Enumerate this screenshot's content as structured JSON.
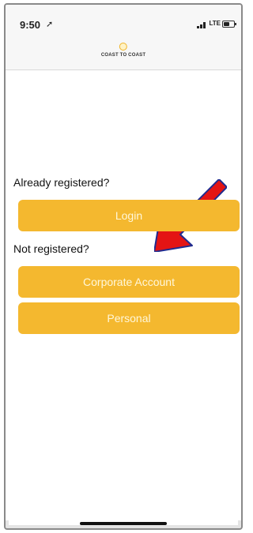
{
  "status_bar": {
    "time": "9:50",
    "time_arrow": "➚",
    "network": "LTE",
    "battery_level": 0.55
  },
  "nav": {
    "logo_text": "COAST TO COAST"
  },
  "main": {
    "registered_prompt": "Already registered?",
    "login_label": "Login",
    "not_registered_prompt": "Not registered?",
    "corporate_label": "Corporate Account",
    "personal_label": "Personal"
  },
  "colors": {
    "button": "#f4b82f",
    "arrow": "#e41414"
  },
  "annotations": {
    "arrow_icon": "red-pointer-arrow"
  }
}
